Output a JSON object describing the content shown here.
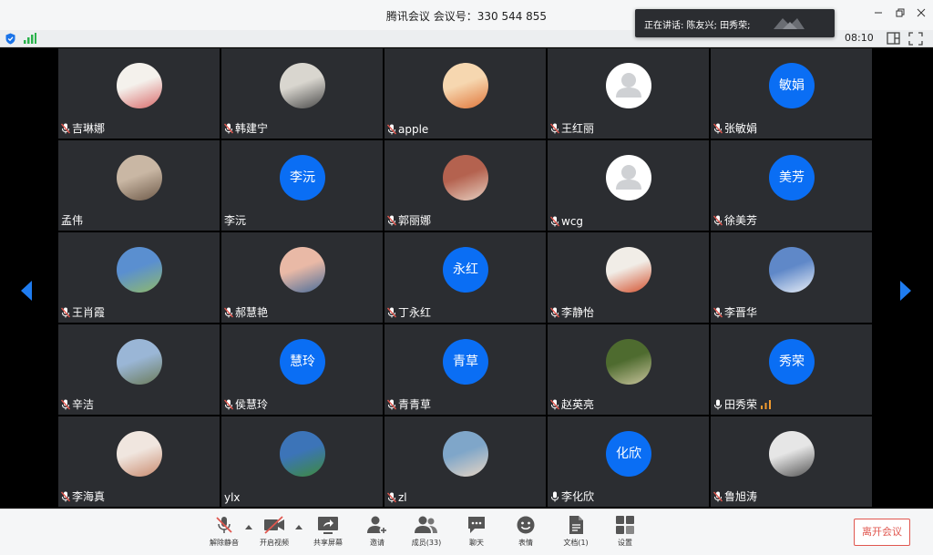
{
  "window": {
    "title": "腾讯会议 会议号：330 544 855",
    "minimize_icon": "minimize-icon",
    "restore_icon": "restore-icon",
    "close_icon": "close-icon"
  },
  "status": {
    "time": "08:10",
    "shield_icon": "shield-icon",
    "signal_icon": "signal-icon"
  },
  "toast": {
    "text": "正在讲话: 陈友兴; 田秀荣;"
  },
  "participants": [
    {
      "name": "吉琳娜",
      "avatar": "photo",
      "mic": "muted"
    },
    {
      "name": "韩建宁",
      "avatar": "photo",
      "mic": "muted"
    },
    {
      "name": "apple",
      "avatar": "photo",
      "mic": "muted"
    },
    {
      "name": "王红丽",
      "avatar": "default",
      "mic": "muted"
    },
    {
      "name": "张敏娟",
      "avatar": "text",
      "avatar_text": "敏娟",
      "mic": "muted"
    },
    {
      "name": "孟伟",
      "avatar": "photo",
      "mic": "none"
    },
    {
      "name": "李沅",
      "avatar": "text",
      "avatar_text": "李沅",
      "mic": "none"
    },
    {
      "name": "郭丽娜",
      "avatar": "photo",
      "mic": "muted"
    },
    {
      "name": "wcg",
      "avatar": "default",
      "mic": "muted"
    },
    {
      "name": "徐美芳",
      "avatar": "text",
      "avatar_text": "美芳",
      "mic": "muted"
    },
    {
      "name": "王肖霞",
      "avatar": "photo",
      "mic": "muted"
    },
    {
      "name": "郝慧艳",
      "avatar": "photo",
      "mic": "muted"
    },
    {
      "name": "丁永红",
      "avatar": "text",
      "avatar_text": "永红",
      "mic": "muted"
    },
    {
      "name": "李静怡",
      "avatar": "photo",
      "mic": "muted"
    },
    {
      "name": "李晋华",
      "avatar": "photo",
      "mic": "muted"
    },
    {
      "name": "辛洁",
      "avatar": "photo",
      "mic": "muted"
    },
    {
      "name": "侯慧玲",
      "avatar": "text",
      "avatar_text": "慧玲",
      "mic": "muted"
    },
    {
      "name": "青青草",
      "avatar": "text",
      "avatar_text": "青草",
      "mic": "muted"
    },
    {
      "name": "赵英亮",
      "avatar": "photo",
      "mic": "muted"
    },
    {
      "name": "田秀荣",
      "avatar": "text",
      "avatar_text": "秀荣",
      "mic": "on",
      "speaking": true
    },
    {
      "name": "李海真",
      "avatar": "photo",
      "mic": "muted"
    },
    {
      "name": "ylx",
      "avatar": "photo",
      "mic": "none"
    },
    {
      "name": "zl",
      "avatar": "photo",
      "mic": "muted"
    },
    {
      "name": "李化欣",
      "avatar": "text",
      "avatar_text": "化欣",
      "mic": "on"
    },
    {
      "name": "鲁旭涛",
      "avatar": "photo",
      "mic": "muted"
    }
  ],
  "toolbar": {
    "unmute": "解除静音",
    "start_video": "开启视频",
    "share_screen": "共享屏幕",
    "invite": "邀请",
    "members": "成员(33)",
    "chat": "聊天",
    "reactions": "表情",
    "docs": "文档(1)",
    "settings": "设置",
    "leave": "离开会议"
  },
  "colors": {
    "accent": "#0a6ef4",
    "tile_bg": "#2b2d31",
    "leave": "#e0574f",
    "muted_mic": "#e0574f",
    "volume": "#f29b2f"
  }
}
